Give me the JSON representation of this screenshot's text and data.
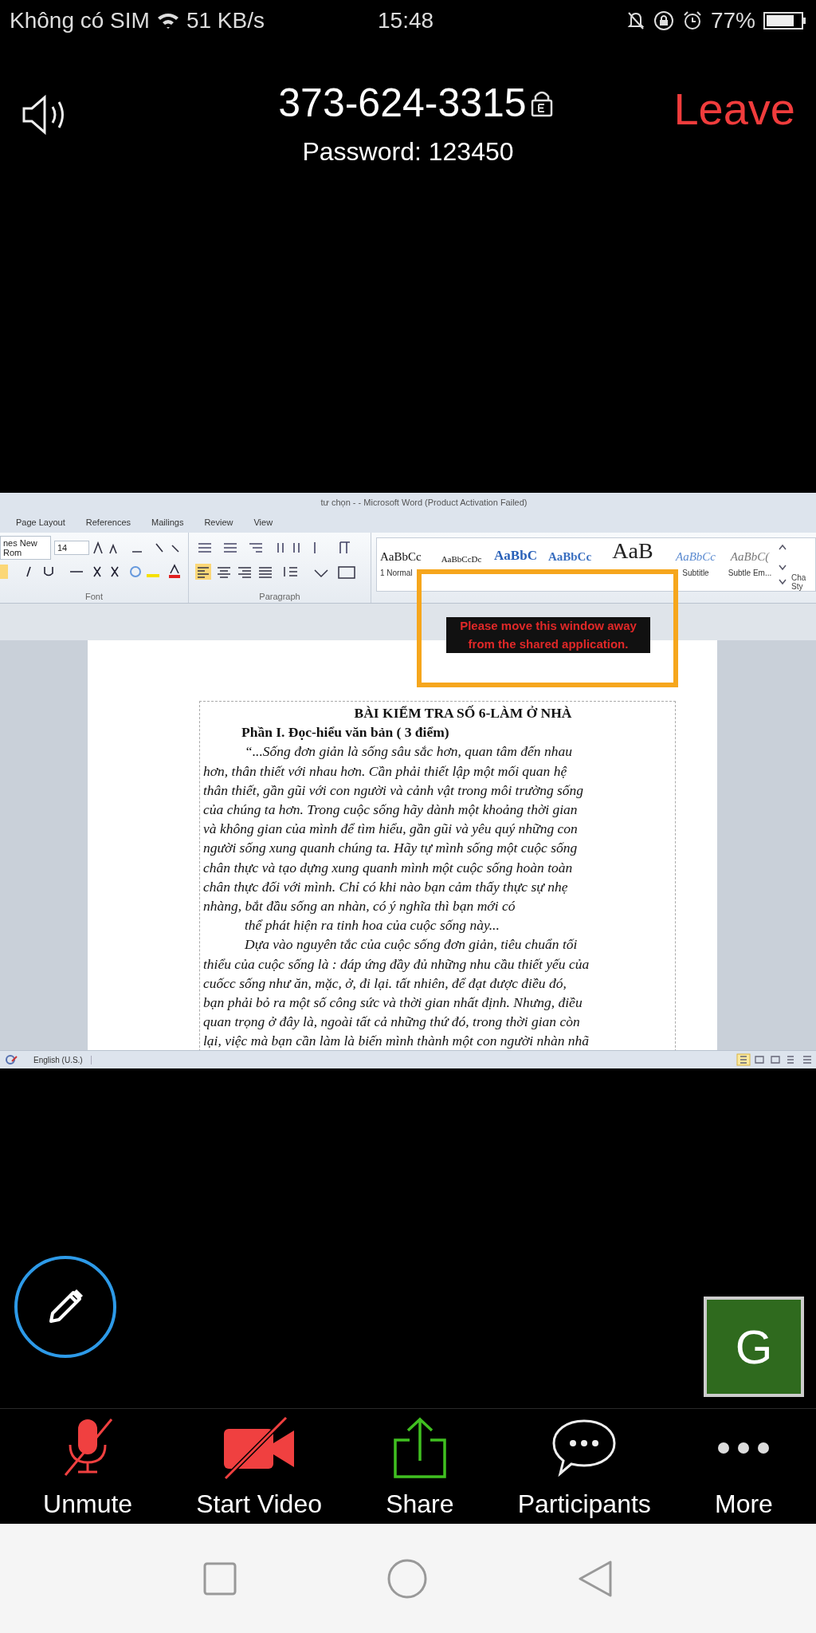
{
  "status_bar": {
    "carrier": "Không có SIM",
    "speed": "51 KB/s",
    "time": "15:48",
    "battery": "77%"
  },
  "meeting": {
    "id": "373-624-3315",
    "password": "Password: 123450",
    "leave": "Leave"
  },
  "shared_window": {
    "title": "tư chọn - - Microsoft Word (Product Activation Failed)",
    "tabs": [
      "Page Layout",
      "References",
      "Mailings",
      "Review",
      "View"
    ],
    "font_name": "nes New Rom",
    "font_size": "14",
    "groups": [
      "Font",
      "Paragraph"
    ],
    "styles": [
      {
        "sample": "AaBbCc",
        "label": "1 Normal",
        "kind": "normal"
      },
      {
        "sample": "AaBbCcDc",
        "kind": "small"
      },
      {
        "sample": "AaBbC",
        "kind": "heading"
      },
      {
        "sample": "AaBbCc",
        "kind": "heading2"
      },
      {
        "sample": "AaB",
        "kind": "title"
      },
      {
        "sample": "AaBbCc",
        "label": "Subtitle",
        "kind": "subtitle"
      },
      {
        "sample": "AaBbC(",
        "label": "Subtle Em...",
        "kind": "subtle"
      }
    ],
    "change_styles": "Cha Sty",
    "warning": "Please move this window away from the shared application.",
    "document": {
      "title": "BÀI KIỂM TRA SỐ 6-LÀM Ở NHÀ",
      "heading": "Phần I. Đọc-hiểu văn bản ( 3 điểm)",
      "paragraphs": [
        {
          "lines": [
            "“...Sống đơn giản là sống sâu sắc hơn, quan tâm đến nhau",
            "hơn, thân thiết với nhau hơn. Cần phải thiết lập một mối quan hệ",
            "thân thiết, gần gũi với con người và cảnh vật trong môi trường sống",
            "của chúng ta hơn. Trong cuộc sống hãy dành một khoảng thời gian",
            "và không gian của mình để tìm hiểu, gần gũi và yêu quý những con",
            "người sống xung quanh chúng ta. Hãy tự mình sống một cuộc sống",
            "chân thực và tạo dựng xung quanh mình một cuộc sống hoàn toàn",
            "chân thực đối với mình. Chỉ có khi nào bạn cảm thấy thực sự nhẹ",
            "nhàng, bắt đầu sống an nhàn, có ý nghĩa thì bạn mới có",
            "thể phát hiện ra tinh hoa của cuộc sống này..."
          ]
        },
        {
          "lines": [
            "Dựa vào nguyên tắc của cuộc sống đơn giản, tiêu chuẩn tối",
            "thiểu của cuộc sống là : đáp ứng đầy đủ những nhu cầu thiết yếu của",
            "cuốcc sống như ăn, mặc, ở, đi lại. tất nhiên, để đạt được điều đó,",
            "bạn phải bỏ ra một số công sức và thời gian nhất định. Nhưng, điều",
            "quan trọng ở đây là, ngoài tất cả những thứ đó, trong thời gian còn",
            "lại, việc mà bạn cần làm là biến mình thành một con người nhàn nhã"
          ]
        }
      ]
    },
    "language": "English (U.S.)"
  },
  "participant": {
    "initial": "G"
  },
  "toolbar": [
    {
      "label": "Unmute",
      "kind": "mic-off"
    },
    {
      "label": "Start Video",
      "kind": "video-off"
    },
    {
      "label": "Share",
      "kind": "share"
    },
    {
      "label": "Participants",
      "kind": "participants"
    },
    {
      "label": "More",
      "kind": "more"
    }
  ]
}
